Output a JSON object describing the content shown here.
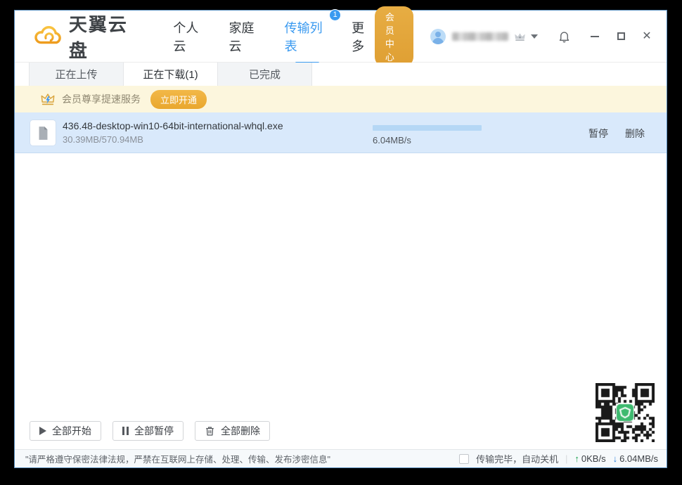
{
  "titlebar": {
    "logo_text": "天翼云盘",
    "nav": {
      "items": [
        {
          "label": "个人云"
        },
        {
          "label": "家庭云"
        },
        {
          "label": "传输列表",
          "badge": "1"
        },
        {
          "label": "更多"
        }
      ]
    },
    "member_center_label": "会员中心",
    "window_controls": {
      "close_glyph": "✕"
    }
  },
  "tabs": {
    "items": [
      {
        "label": "正在上传"
      },
      {
        "label": "正在下载(1)"
      },
      {
        "label": "已完成"
      }
    ]
  },
  "banner": {
    "text": "会员尊享提速服务",
    "button_label": "立即开通"
  },
  "download_item": {
    "filename": "436.48-desktop-win10-64bit-international-whql.exe",
    "size_text": "30.39MB/570.94MB",
    "speed": "6.04MB/s",
    "progress_percent": 8,
    "pause_label": "暂停",
    "delete_label": "删除"
  },
  "footer": {
    "start_all_label": "全部开始",
    "pause_all_label": "全部暂停",
    "delete_all_label": "全部删除"
  },
  "statusbar": {
    "notice": "\"请严格遵守保密法律法规，严禁在互联网上存储、处理、传输、发布涉密信息\"",
    "shutdown_checkbox_label": "传输完毕，自动关机",
    "upload_arrow": "↑",
    "upload_speed": "0KB/s",
    "download_arrow": "↓",
    "download_speed": "6.04MB/s"
  },
  "colors": {
    "accent_blue": "#3a9af0",
    "gold": "#e2a63c",
    "banner_bg": "#fcf6dd",
    "row_selected_bg": "#d9e9fb",
    "progress_track": "#b5d7f5",
    "progress_fill": "#2b80d9",
    "upload_green": "#1ea24f",
    "download_blue": "#2a7fd9",
    "qr_center_green": "#3dba6f"
  }
}
